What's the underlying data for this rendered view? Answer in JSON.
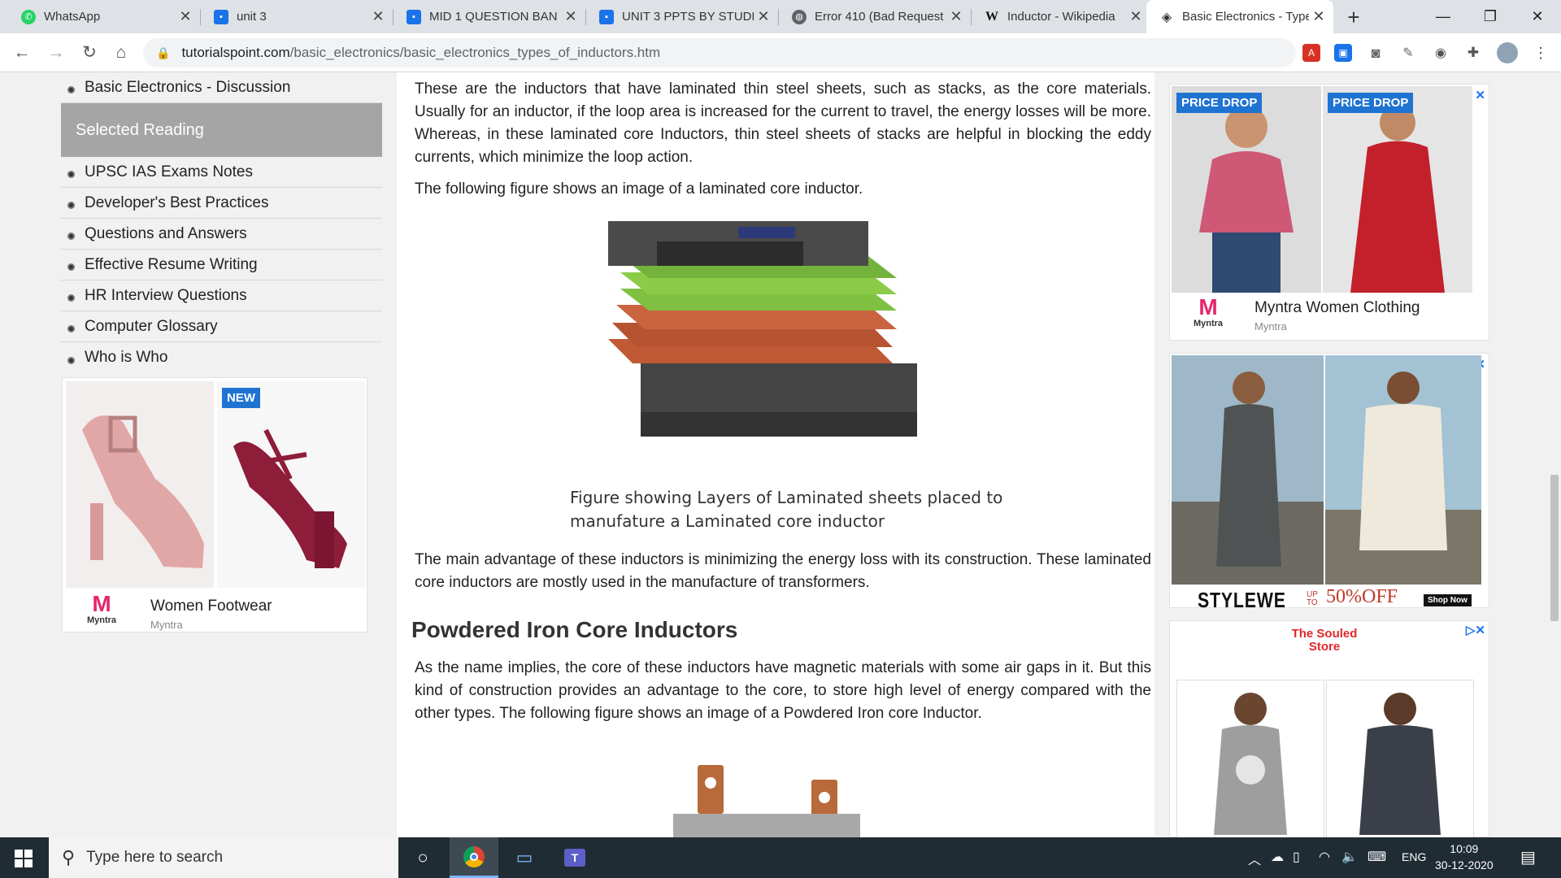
{
  "browser": {
    "tabs": [
      {
        "title": "WhatsApp",
        "icon": "whatsapp-icon",
        "active": false
      },
      {
        "title": "unit 3",
        "icon": "docs-icon",
        "active": false
      },
      {
        "title": "MID 1 QUESTION BAN",
        "icon": "docs-icon",
        "active": false
      },
      {
        "title": "UNIT 3 PPTS BY STUDE",
        "icon": "docs-icon",
        "active": false
      },
      {
        "title": "Error 410 (Bad Request",
        "icon": "globe-icon",
        "active": false
      },
      {
        "title": "Inductor - Wikipedia",
        "icon": "wikipedia-icon",
        "active": false
      },
      {
        "title": "Basic Electronics - Type",
        "icon": "tutorialspoint-icon",
        "active": true
      }
    ],
    "url_host": "tutorialspoint.com",
    "url_path": "/basic_electronics/basic_electronics_types_of_inductors.htm"
  },
  "sidebar": {
    "top_item": "Basic Electronics - Discussion",
    "selected_reading_label": "Selected Reading",
    "items": [
      "UPSC IAS Exams Notes",
      "Developer's Best Practices",
      "Questions and Answers",
      "Effective Resume Writing",
      "HR Interview Questions",
      "Computer Glossary",
      "Who is Who"
    ]
  },
  "left_ad": {
    "badge": "NEW",
    "title": "Women Footwear",
    "brand": "Myntra",
    "logo_text": "Myntra"
  },
  "article": {
    "para1": "These are the inductors that have laminated thin steel sheets, such as stacks, as the core materials. Usually for an inductor, if the loop area is increased for the current to travel, the energy losses will be more. Whereas, in these laminated core Inductors, thin steel sheets of stacks are helpful in blocking the eddy currents, which minimize the loop action.",
    "para2": "The following figure shows an image of a laminated core inductor.",
    "caption": "Figure showing Layers of Laminated sheets placed to manufature a Laminated core inductor",
    "para3": "The main advantage of these inductors is minimizing the energy loss with its construction. These laminated core inductors are mostly used in the manufacture of transformers.",
    "heading": "Powdered Iron Core Inductors",
    "para4": "As the name implies, the core of these inductors have magnetic materials with some air gaps in it. But this kind of construction provides an advantage to the core, to store high level of energy compared with the other types. The following figure shows an image of a Powdered Iron core Inductor."
  },
  "right_ads": {
    "ad1_badge_left": "PRICE DROP",
    "ad1_badge_right": "PRICE DROP",
    "ad1_title": "Myntra Women Clothing",
    "ad1_brand": "Myntra",
    "ad1_logo_text": "Myntra",
    "ad2_brand": "STYLEWE",
    "ad2_offer_prefix": "UP TO",
    "ad2_offer": "50%OFF",
    "ad2_cta": "Shop Now",
    "ad3_logo": "The Souled Store"
  },
  "taskbar": {
    "search_placeholder": "Type here to search",
    "language": "ENG",
    "time": "10:09",
    "date": "30-12-2020"
  },
  "colors": {
    "accent_blue": "#1f73d1",
    "myntra_pink": "#e6256c",
    "selected_reading_bg": "#a5a5a5",
    "taskbar_bg": "#1f2c33"
  }
}
